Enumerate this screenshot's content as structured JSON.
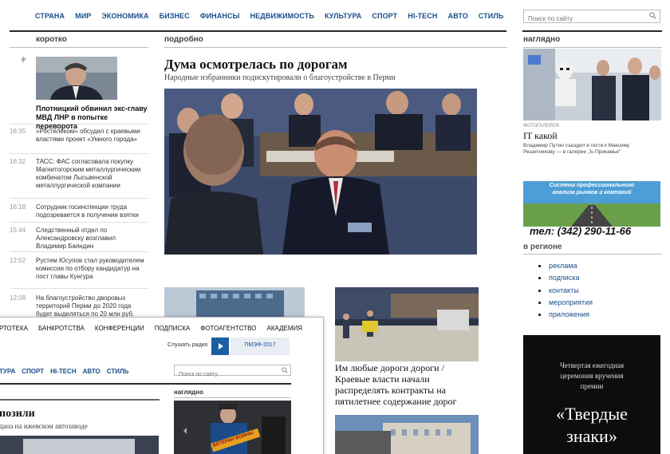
{
  "nav": {
    "items": [
      "СТРАНА",
      "МИР",
      "ЭКОНОМИКА",
      "БИЗНЕС",
      "ФИНАНСЫ",
      "НЕДВИЖИМОСТЬ",
      "КУЛЬТУРА",
      "СПОРТ",
      "HI-TECH",
      "АВТО",
      "СТИЛЬ"
    ],
    "search_placeholder": "Поиск по сайту"
  },
  "sections": {
    "short": "коротко",
    "detail": "подробно",
    "visual": "наглядно",
    "region": "в регионе"
  },
  "left": {
    "lead_caption": "Плотницкий обвинил экс-главу МВД ЛНР в попытке переворота",
    "news": [
      {
        "time": "16:35",
        "text": "«Ростелеком» обсудил с краевыми властями проект «Умного города»"
      },
      {
        "time": "16:32",
        "text": "ТАСС: ФАС согласовала покупку Магнитогорским металлургическим комбинатом Лысьвенской металлургической компании"
      },
      {
        "time": "16:18",
        "text": "Сотрудник госинспекции труда подозревается в получении взятки"
      },
      {
        "time": "15:44",
        "text": "Следственный отдел по Александровску возглавил Владимир Баяндин"
      },
      {
        "time": "12:52",
        "text": "Рустем Юсупов стал руководителем комиссии по отбору кандидатур на пост главы Кунгура"
      },
      {
        "time": "12:08",
        "text": "На благоустройство дворовых территорий Перми до 2020 года будет выделяться по 20 млн руб."
      }
    ]
  },
  "main": {
    "headline": "Дума осмотрелась по дорогам",
    "subheadline": "Народные избранники подискутировали о благоустройстве в Перми",
    "second_caption": "Им любые дороги дороги / Краевые власти начали распределять контракты на пятилетнее содержание дорог"
  },
  "right": {
    "gallery_label": "ФОТОГАЛЕРЕЯ:",
    "gallery_title": "IT какой",
    "gallery_text": "Владимир Путин съездил в гости к Максиму Решетникову — в галерее „Ъ-Прикамье\"",
    "ad_line1": "Система профессионального",
    "ad_line2": "анализа рынков и компаний",
    "ad_phone": "тел: (342) 290-11-66",
    "region_items": [
      "реклама",
      "подписка",
      "контакты",
      "мероприятия",
      "приложения"
    ],
    "award_line1": "Четвертая ежегодная",
    "award_line2": "церемония вручения",
    "award_line3": "премии",
    "award_title1": "«Твердые",
    "award_title2": "знаки»"
  },
  "overlay": {
    "nav1": [
      "РТОТЕКА",
      "БАНКРОТСТВА",
      "КОНФЕРЕНЦИИ",
      "ПОДПИСКА",
      "ФОТОАГЕНТСТВО",
      "АКАДЕМИЯ"
    ],
    "listen_label": "Слушать радио",
    "pmef_label": "ПМЭФ-2017",
    "nav2": [
      "ТУРА",
      "СПОРТ",
      "HI-TECH",
      "АВТО",
      "СТИЛЬ"
    ],
    "search_placeholder": "Поиск по сайту",
    "visual_label": "наглядно",
    "headline": "позили",
    "subheadline": "дана на ижевском автозаводе",
    "ribbon_text": "ВЕТЕРАН ВОЙНЫ"
  }
}
